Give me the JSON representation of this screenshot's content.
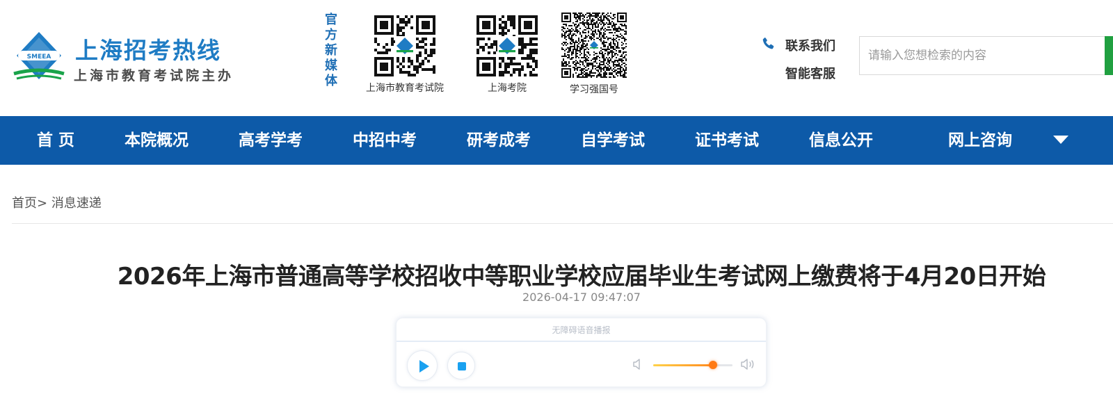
{
  "site": {
    "title": "上海招考热线",
    "subtitle": "上海市教育考试院主办",
    "logo_text": "SMEEA"
  },
  "media": {
    "label": "官方新媒体",
    "qrcodes": [
      {
        "caption": "上海市教育考试院",
        "icon": "qr-code-wechat"
      },
      {
        "caption": "上海考院",
        "icon": "qr-code-weibo"
      },
      {
        "caption": "学习强国号",
        "icon": "qr-code-xuexi"
      }
    ]
  },
  "contact": {
    "contact_us": "联系我们",
    "smart_service": "智能客服",
    "icon": "phone-icon"
  },
  "search": {
    "placeholder": "请输入您想检索的内容",
    "value": ""
  },
  "nav": {
    "items": [
      {
        "label": "首 页"
      },
      {
        "label": "本院概况"
      },
      {
        "label": "高考学考"
      },
      {
        "label": "中招中考"
      },
      {
        "label": "研考成考"
      },
      {
        "label": "自学考试"
      },
      {
        "label": "证书考试"
      },
      {
        "label": "信息公开"
      },
      {
        "label": "网上咨询"
      }
    ],
    "more_icon": "caret-down-icon"
  },
  "breadcrumb": {
    "home": "首页",
    "separator": ">",
    "current": "消息速递"
  },
  "article": {
    "title": "2026年上海市普通高等学校招收中等职业学校应届毕业生考试网上缴费将于4月20日开始",
    "date": "2026-04-17 09:47:07"
  },
  "player": {
    "header": "无障碍语音播报",
    "volume_fraction": 0.75
  },
  "colors": {
    "brand_blue": "#1f7cc4",
    "nav_bg": "#0d5aa8",
    "search_accent": "#20a040",
    "volume_accent": "#ff7a14"
  }
}
